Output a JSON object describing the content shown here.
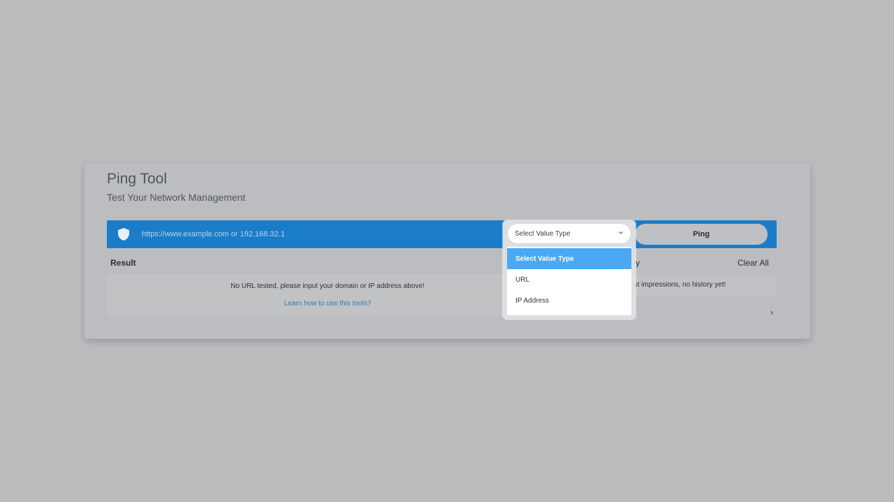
{
  "tool": {
    "title": "Ping Tool",
    "subtitle": "Test Your Network Management"
  },
  "input": {
    "placeholder": "https://www.example.com or 192.168.32.1"
  },
  "select": {
    "current": "Select Value Type",
    "options": [
      "Select Value Type",
      "URL",
      "IP Address"
    ],
    "highlighted": "Select Value Type"
  },
  "ping_label": "Ping",
  "result": {
    "label": "Result",
    "message": "No URL tested, please input your domain or IP address above!",
    "link": "Learn how to use this tools?"
  },
  "history": {
    "label_visible": "tory",
    "clear_label": "Clear All",
    "message_visible": "u' first impressions, no history yet!"
  },
  "colors": {
    "accent": "#1b7cc8",
    "highlight": "#4ba8f3",
    "link": "#2f78c4"
  }
}
